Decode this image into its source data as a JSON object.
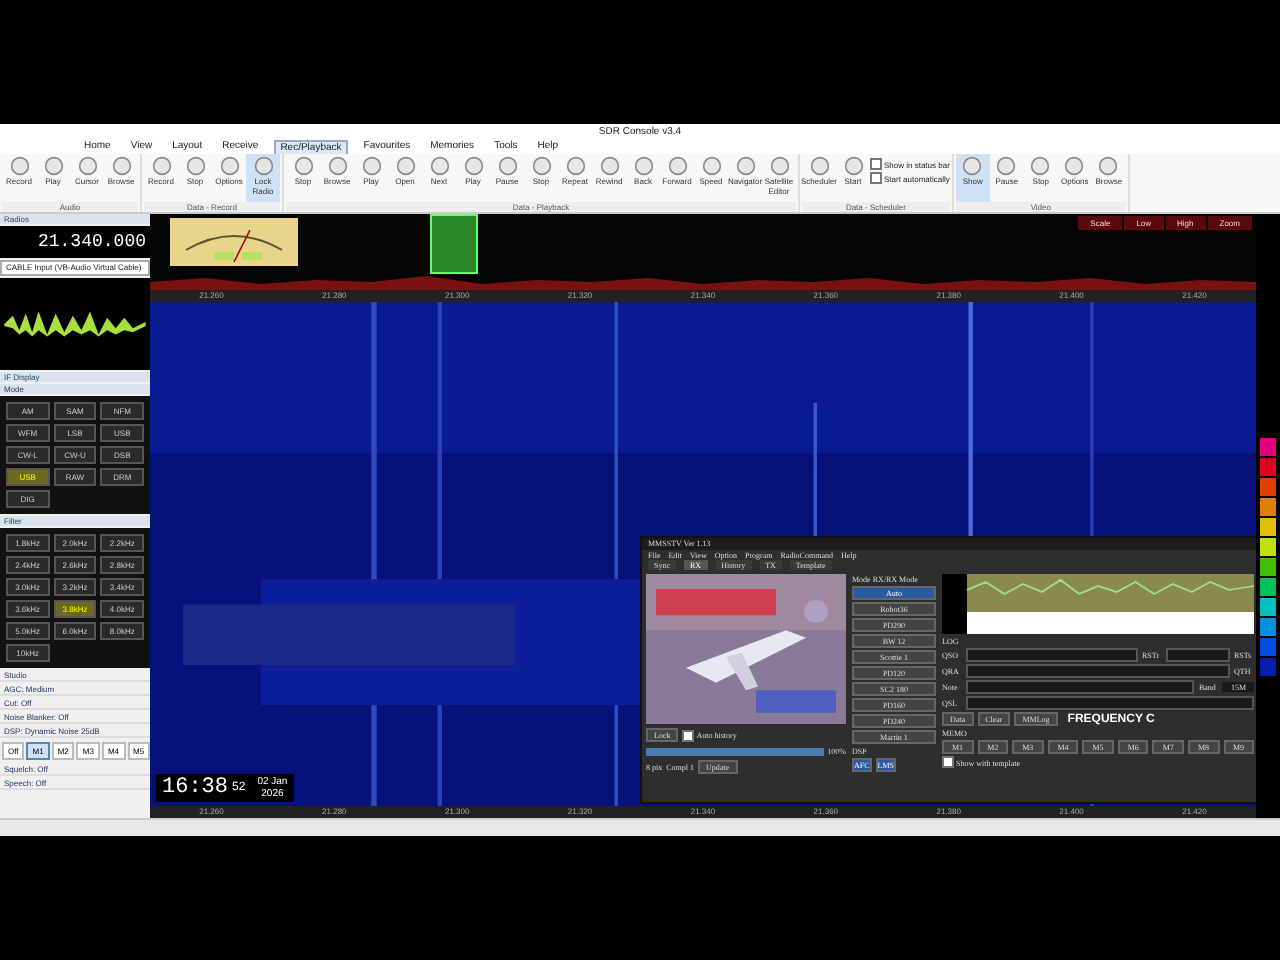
{
  "window": {
    "title": "SDR Console v3.4"
  },
  "menu": [
    {
      "label": "Home",
      "selected": false
    },
    {
      "label": "View",
      "selected": false
    },
    {
      "label": "Layout",
      "selected": false
    },
    {
      "label": "Receive",
      "selected": false
    },
    {
      "label": "Rec/Playback",
      "selected": true
    },
    {
      "label": "Favourites",
      "selected": false
    },
    {
      "label": "Memories",
      "selected": false
    },
    {
      "label": "Tools",
      "selected": false
    },
    {
      "label": "Help",
      "selected": false
    }
  ],
  "ribbon_groups": [
    {
      "label": "Audio",
      "buttons": [
        {
          "label": "Record",
          "selected": false
        },
        {
          "label": "Play",
          "selected": false
        },
        {
          "label": "Cursor",
          "selected": false
        },
        {
          "label": "Browse",
          "selected": false
        }
      ]
    },
    {
      "label": "Data - Record",
      "buttons": [
        {
          "label": "Record",
          "selected": false
        },
        {
          "label": "Stop",
          "selected": false
        },
        {
          "label": "Options",
          "selected": false
        },
        {
          "label": "Lock Radio",
          "selected": true
        }
      ]
    },
    {
      "label": "Data - Playback",
      "buttons": [
        {
          "label": "Stop",
          "selected": false
        },
        {
          "label": "Browse",
          "selected": false
        },
        {
          "label": "Play",
          "selected": false
        },
        {
          "label": "Open",
          "selected": false
        },
        {
          "label": "Next",
          "selected": false
        },
        {
          "label": "Play",
          "selected": false
        },
        {
          "label": "Pause",
          "selected": false
        },
        {
          "label": "Stop",
          "selected": false
        },
        {
          "label": "Repeat",
          "selected": false
        },
        {
          "label": "Rewind",
          "selected": false
        },
        {
          "label": "Back",
          "selected": false
        },
        {
          "label": "Forward",
          "selected": false
        },
        {
          "label": "Speed",
          "selected": false
        },
        {
          "label": "Navigator",
          "selected": false
        },
        {
          "label": "Satellite Editor",
          "selected": false
        }
      ]
    },
    {
      "label": "Data - Scheduler",
      "buttons": [
        {
          "label": "Scheduler",
          "selected": false
        },
        {
          "label": "Start",
          "selected": false
        }
      ],
      "checks": [
        {
          "label": "Show in status bar",
          "checked": false
        },
        {
          "label": "Start automatically",
          "checked": false
        }
      ]
    },
    {
      "label": "Video",
      "buttons": [
        {
          "label": "Show",
          "selected": true
        },
        {
          "label": "Pause",
          "selected": false
        },
        {
          "label": "Stop",
          "selected": false
        },
        {
          "label": "Options",
          "selected": false
        },
        {
          "label": "Browse",
          "selected": false
        }
      ]
    }
  ],
  "left": {
    "radios_title": "Radios",
    "frequency": "21.340.000",
    "audio_device": "CABLE Input (VB-Audio Virtual Cable)",
    "if_title": "IF Display",
    "mode_title": "Mode",
    "modes": [
      {
        "label": "AM",
        "selected": false
      },
      {
        "label": "SAM",
        "selected": false
      },
      {
        "label": "NFM",
        "selected": false
      },
      {
        "label": "WFM",
        "selected": false
      },
      {
        "label": "LSB",
        "selected": false
      },
      {
        "label": "USB",
        "selected": false
      },
      {
        "label": "CW-L",
        "selected": false
      },
      {
        "label": "CW-U",
        "selected": false
      },
      {
        "label": "DSB",
        "selected": false
      },
      {
        "label": "USB",
        "selected": true
      },
      {
        "label": "RAW",
        "selected": false
      },
      {
        "label": "DRM",
        "selected": false
      },
      {
        "label": "DIG",
        "selected": false
      }
    ],
    "filter_title": "Filter",
    "filters": [
      {
        "label": "1.8kHz",
        "selected": false
      },
      {
        "label": "2.0kHz",
        "selected": false
      },
      {
        "label": "2.2kHz",
        "selected": false
      },
      {
        "label": "2.4kHz",
        "selected": false
      },
      {
        "label": "2.6kHz",
        "selected": false
      },
      {
        "label": "2.8kHz",
        "selected": false
      },
      {
        "label": "3.0kHz",
        "selected": false
      },
      {
        "label": "3.2kHz",
        "selected": false
      },
      {
        "label": "3.4kHz",
        "selected": false
      },
      {
        "label": "3.6kHz",
        "selected": false
      },
      {
        "label": "3.8kHz",
        "selected": true
      },
      {
        "label": "4.0kHz",
        "selected": false
      },
      {
        "label": "5.0kHz",
        "selected": false
      },
      {
        "label": "6.0kHz",
        "selected": false
      },
      {
        "label": "8.0kHz",
        "selected": false
      },
      {
        "label": "10kHz",
        "selected": false
      }
    ],
    "settings": [
      "Studio",
      "AGC: Medium",
      "Cut: Off",
      "Noise Blanker: Off",
      "DSP: Dynamic Noise 25dB"
    ],
    "presets": [
      {
        "label": "Off",
        "selected": false
      },
      {
        "label": "M1",
        "selected": true
      },
      {
        "label": "M2",
        "selected": false
      },
      {
        "label": "M3",
        "selected": false
      },
      {
        "label": "M4",
        "selected": false
      },
      {
        "label": "M5",
        "selected": false
      }
    ],
    "squelch": [
      {
        "label": "Squelch: Off"
      },
      {
        "label": "Speech: Off"
      }
    ]
  },
  "spectrum": {
    "buttons": [
      "Scale",
      "Low",
      "High",
      "Zoom"
    ],
    "ticks": [
      "21.260",
      "21.280",
      "21.300",
      "21.320",
      "21.340",
      "21.360",
      "21.380",
      "21.400",
      "21.420"
    ],
    "bottom_ticks": [
      "21.260",
      "21.280",
      "21.300",
      "21.320",
      "21.340",
      "21.360",
      "21.380",
      "21.400",
      "21.420"
    ]
  },
  "clock": {
    "time": "16:38",
    "seconds": "52",
    "date": "02 Jan",
    "year": "2026"
  },
  "mmsstv": {
    "title": "MMSSTV Ver 1.13",
    "menu": [
      "File",
      "Edit",
      "View",
      "Option",
      "Program",
      "RadioCommand",
      "Help"
    ],
    "tabs": [
      {
        "label": "Sync",
        "selected": false
      },
      {
        "label": "RX",
        "selected": true
      },
      {
        "label": "History",
        "selected": false
      },
      {
        "label": "TX",
        "selected": false
      },
      {
        "label": "Template",
        "selected": false
      }
    ],
    "mode_title": "Mode RX/RX Mode",
    "modes": [
      {
        "label": "Auto",
        "selected": true
      },
      {
        "label": "Robot36",
        "selected": false
      },
      {
        "label": "PD290",
        "selected": false
      },
      {
        "label": "BW 12",
        "selected": false
      },
      {
        "label": "Scottie 1",
        "selected": false
      },
      {
        "label": "PD120",
        "selected": false
      },
      {
        "label": "SC2 180",
        "selected": false
      },
      {
        "label": "PD160",
        "selected": false
      },
      {
        "label": "PD240",
        "selected": false
      },
      {
        "label": "Martin 1",
        "selected": false
      }
    ],
    "lock": "Lock",
    "auto_history": {
      "label": "Auto history",
      "checked": false
    },
    "progress": {
      "level": 1.0,
      "reading": "100%"
    },
    "bottom": [
      "8 pix",
      "Compl 1",
      "Update"
    ],
    "dsp": "DSP",
    "afc": "AFC",
    "lms": "LMS",
    "log_title": "LOG",
    "fields": [
      "QSO",
      "QRA",
      "Note",
      "QSL"
    ],
    "rst": "RSTr",
    "rst_s": "RSTs",
    "qth": "QTH",
    "band_label": "Band",
    "band": "15M",
    "log_buttons": [
      "Data",
      "Clear",
      "MMLog"
    ],
    "frequency_banner": "FREQUENCY C",
    "memo": "MEMO",
    "memos": [
      "M1",
      "M2",
      "M3",
      "M4",
      "M5",
      "M6",
      "M7",
      "M8",
      "M9"
    ],
    "template": {
      "label": "Show with template",
      "checked": false
    }
  }
}
